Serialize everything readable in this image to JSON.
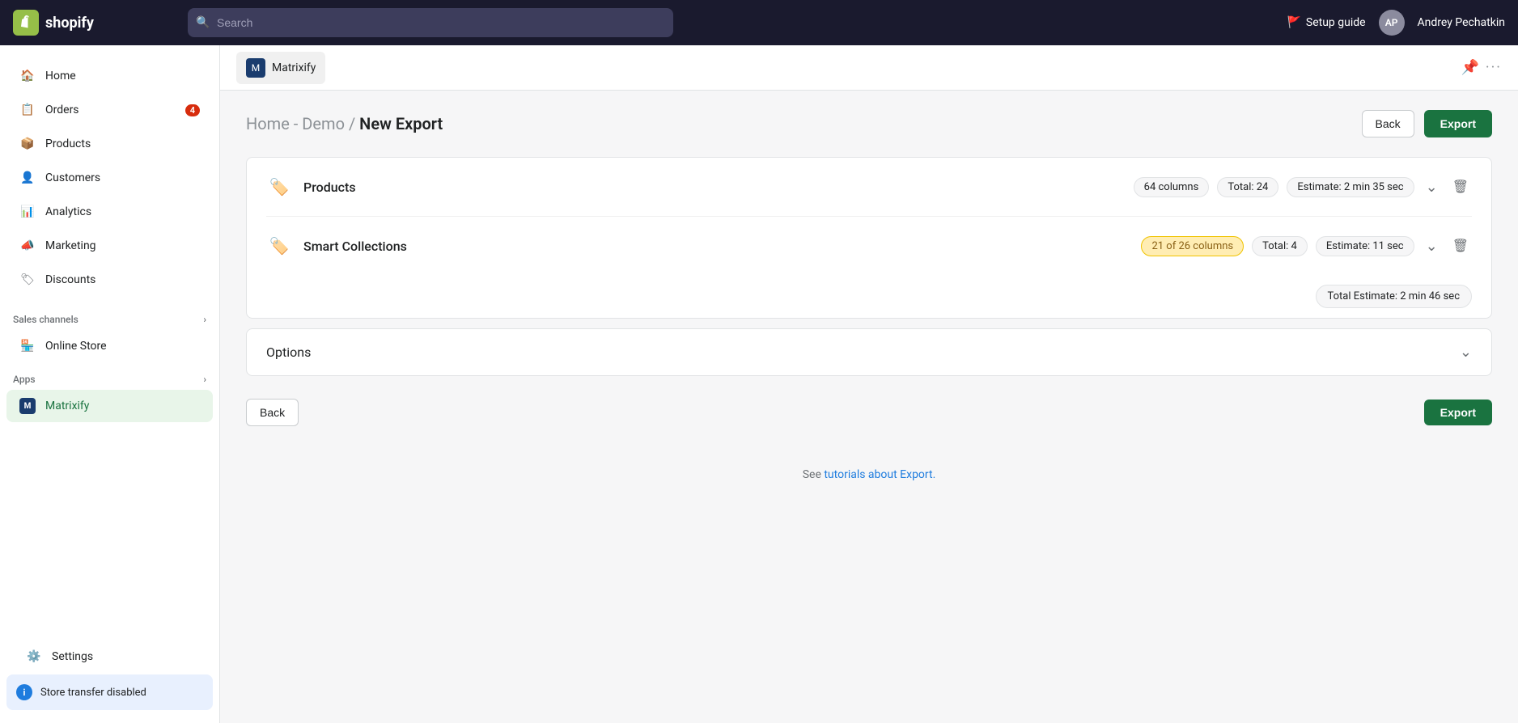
{
  "topbar": {
    "logo_text": "shopify",
    "search_placeholder": "Search",
    "setup_guide_label": "Setup guide",
    "user_initials": "AP",
    "user_name": "Andrey Pechatkin"
  },
  "sidebar": {
    "nav_items": [
      {
        "id": "home",
        "label": "Home",
        "icon": "home"
      },
      {
        "id": "orders",
        "label": "Orders",
        "icon": "orders",
        "badge": "4"
      },
      {
        "id": "products",
        "label": "Products",
        "icon": "products"
      },
      {
        "id": "customers",
        "label": "Customers",
        "icon": "customers"
      },
      {
        "id": "analytics",
        "label": "Analytics",
        "icon": "analytics"
      },
      {
        "id": "marketing",
        "label": "Marketing",
        "icon": "marketing"
      },
      {
        "id": "discounts",
        "label": "Discounts",
        "icon": "discounts"
      }
    ],
    "sales_channels_label": "Sales channels",
    "online_store_label": "Online Store",
    "apps_label": "Apps",
    "matrixify_label": "Matrixify",
    "settings_label": "Settings",
    "store_transfer_label": "Store transfer disabled"
  },
  "app_header": {
    "tab_label": "Matrixify",
    "pin_icon": "📌",
    "more_icon": "···"
  },
  "page": {
    "breadcrumb_home": "Home",
    "breadcrumb_demo": "Demo",
    "breadcrumb_separator": " - ",
    "breadcrumb_slash": " / ",
    "breadcrumb_current": "New Export",
    "back_button": "Back",
    "export_button": "Export"
  },
  "export_items": [
    {
      "id": "products",
      "title": "Products",
      "icon": "🏷️",
      "columns_label": "64 columns",
      "total_label": "Total: 24",
      "estimate_label": "Estimate: 2 min 35 sec",
      "columns_highlight": false
    },
    {
      "id": "smart_collections",
      "title": "Smart Collections",
      "icon": "🏷️",
      "columns_label": "21 of 26 columns",
      "total_label": "Total: 4",
      "estimate_label": "Estimate: 11 sec",
      "columns_highlight": true
    }
  ],
  "total_estimate": {
    "label": "Total Estimate: 2 min 46 sec"
  },
  "options": {
    "title": "Options"
  },
  "footer": {
    "see_label": "See ",
    "link_label": "tutorials about Export.",
    "end_label": ""
  }
}
